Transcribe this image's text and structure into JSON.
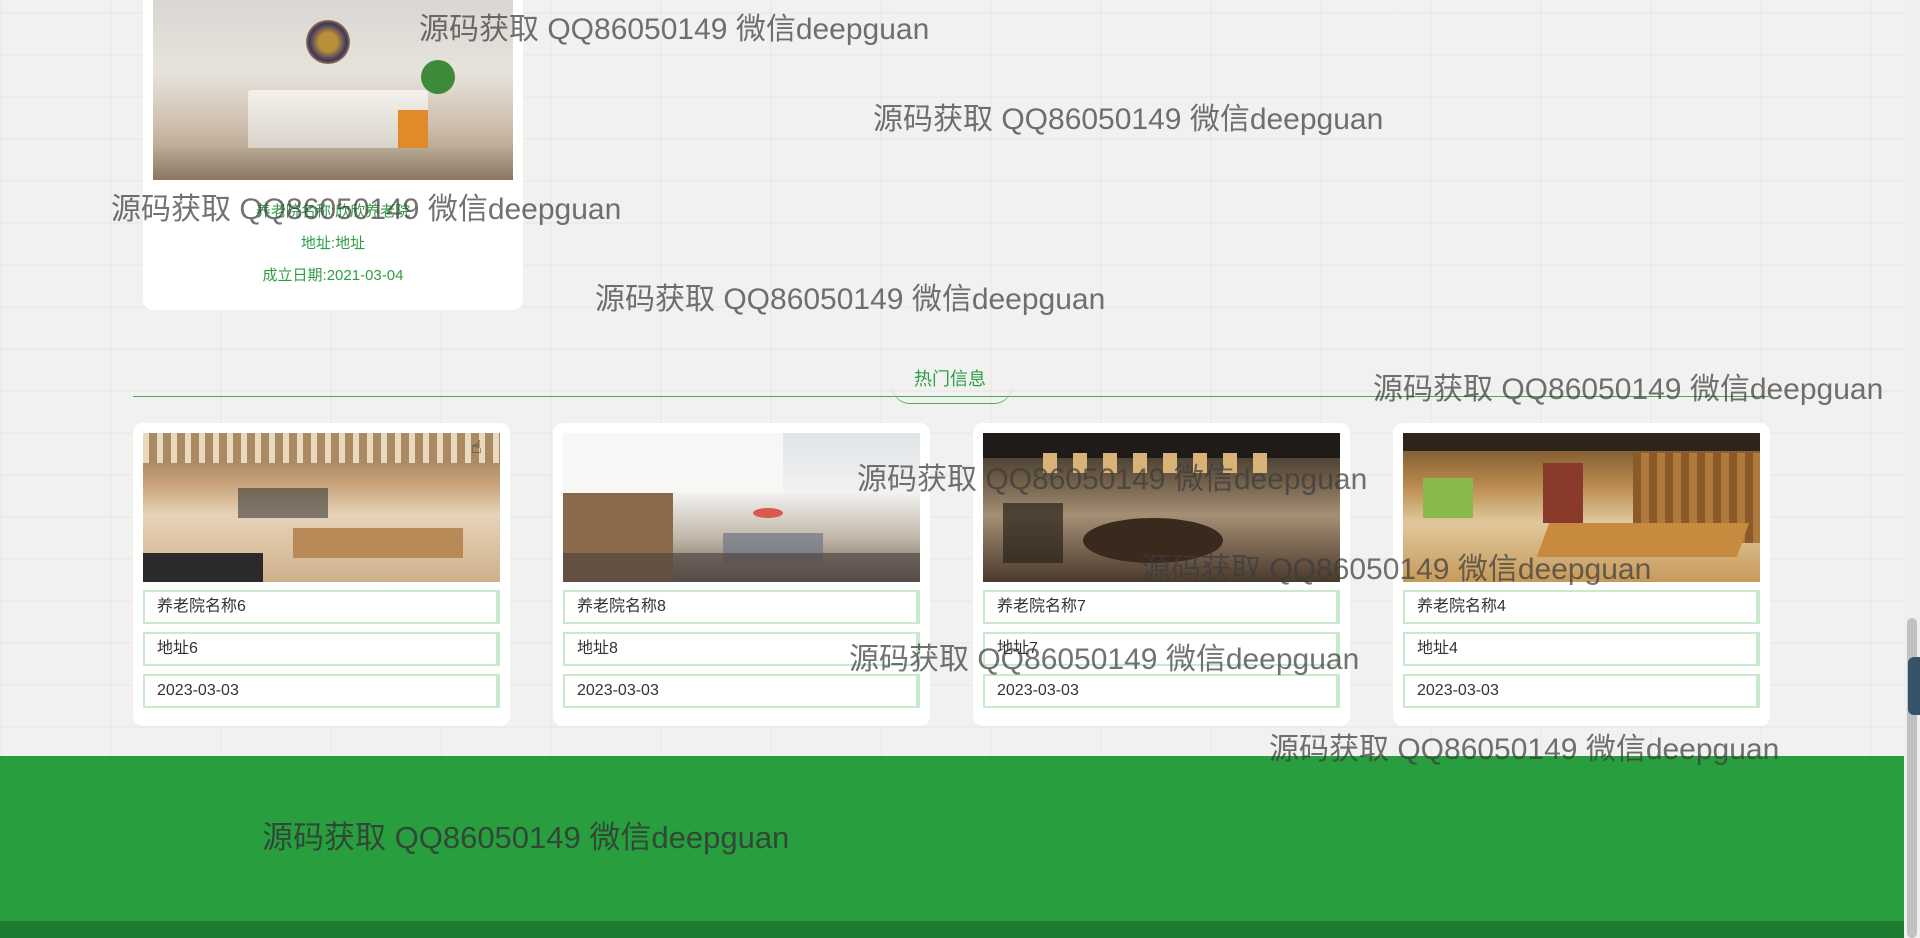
{
  "featured": {
    "name": "养老院名称:欣欣养老院",
    "address": "地址:地址",
    "date": "成立日期:2021-03-04"
  },
  "section": {
    "title": "热门信息"
  },
  "items": [
    {
      "name": "养老院名称6",
      "address": "地址6",
      "date": "2023-03-03"
    },
    {
      "name": "养老院名称8",
      "address": "地址8",
      "date": "2023-03-03"
    },
    {
      "name": "养老院名称7",
      "address": "地址7",
      "date": "2023-03-03"
    },
    {
      "name": "养老院名称4",
      "address": "地址4",
      "date": "2023-03-03"
    }
  ],
  "watermark": {
    "text": "源码获取 QQ86050149 微信deepguan"
  },
  "colors": {
    "accent": "#2e9e44",
    "footer": "#289e3f",
    "field_border": "#c9e9cc"
  }
}
